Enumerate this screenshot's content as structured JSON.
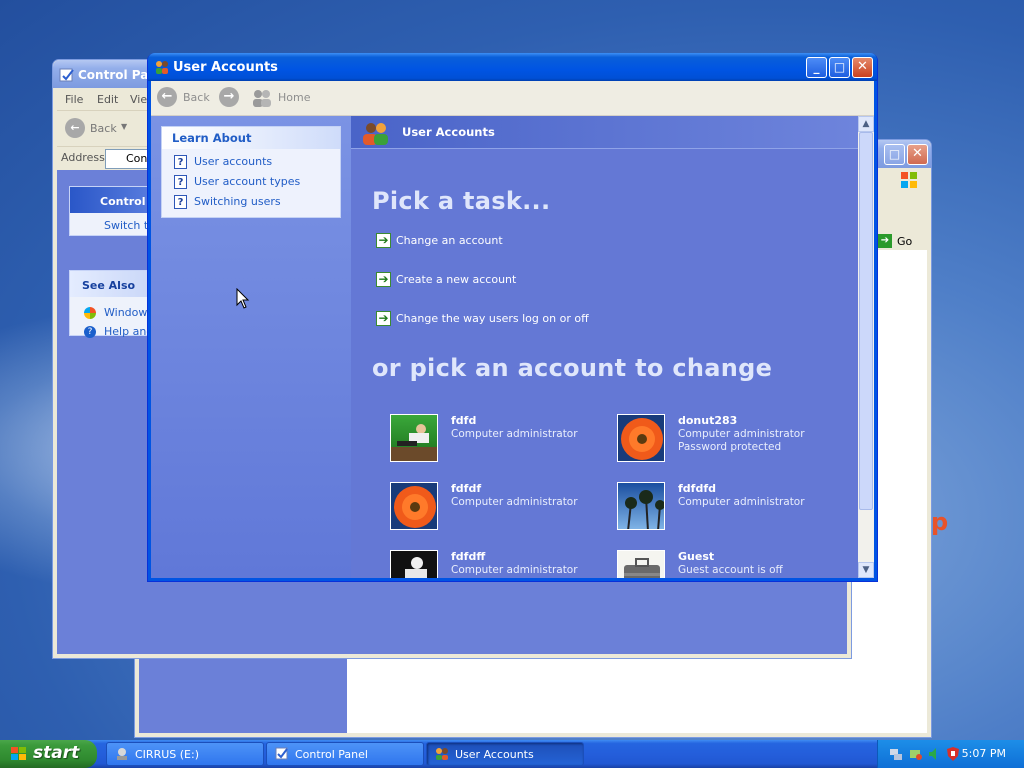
{
  "desktop": {
    "mark": "p"
  },
  "control_panel": {
    "title": "Control Pan",
    "menu": [
      "File",
      "Edit",
      "View"
    ],
    "back_label": "Back",
    "address_label": "Address",
    "address_value": "Con",
    "box1_title": "Control P",
    "box1_item": "Switch to",
    "see_also_title": "See Also",
    "see_also_items": [
      "Windows",
      "Help and"
    ]
  },
  "third_window": {
    "go_label": "Go"
  },
  "user_accounts": {
    "title": "User Accounts",
    "nav": {
      "back": "Back",
      "home": "Home"
    },
    "learn_about": {
      "title": "Learn About",
      "items": [
        "User accounts",
        "User account types",
        "Switching users"
      ]
    },
    "header": "User Accounts",
    "pick_task": "Pick a task...",
    "tasks": [
      "Change an account",
      "Create a new account",
      "Change the way users log on or off"
    ],
    "pick_account": "or pick an account to change",
    "accounts": [
      {
        "name": "fdfd",
        "line1": "Computer administrator",
        "line2": "",
        "picture": "skateboarder"
      },
      {
        "name": "donut283",
        "line1": "Computer administrator",
        "line2": "Password protected",
        "picture": "orange-flower"
      },
      {
        "name": "fdfdf",
        "line1": "Computer administrator",
        "line2": "",
        "picture": "orange-flower"
      },
      {
        "name": "fdfdfd",
        "line1": "Computer administrator",
        "line2": "",
        "picture": "palm-trees"
      },
      {
        "name": "fdfdff",
        "line1": "Computer administrator",
        "line2": "",
        "picture": "snowboarder"
      },
      {
        "name": "Guest",
        "line1": "Guest account is off",
        "line2": "",
        "picture": "briefcase"
      }
    ]
  },
  "taskbar": {
    "start_label": "start",
    "buttons": [
      {
        "label": "CIRRUS (E:)",
        "icon": "drive-icon",
        "active": false
      },
      {
        "label": "Control Panel",
        "icon": "control-panel-icon",
        "active": false
      },
      {
        "label": "User Accounts",
        "icon": "user-accounts-icon",
        "active": true
      }
    ],
    "clock": "5:07 PM"
  },
  "colors": {
    "xp_blue": "#0054e3",
    "task_pane": "#6478d5",
    "start_green": "#3b9a3b"
  }
}
